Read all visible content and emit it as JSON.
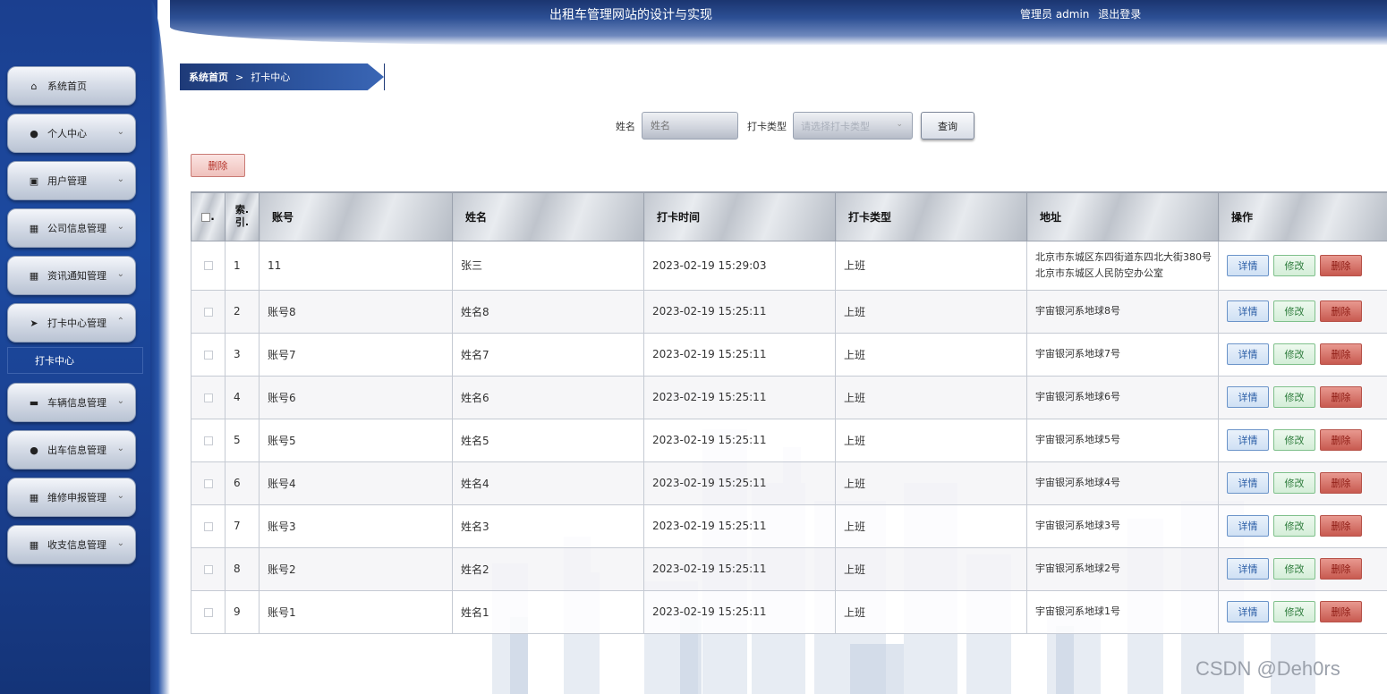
{
  "header": {
    "title": "出租车管理网站的设计与实现",
    "user_label": "管理员 admin",
    "logout_label": "退出登录"
  },
  "sidebar": {
    "items": [
      {
        "label": "系统首页",
        "icon": "home-icon",
        "has_chevron": false
      },
      {
        "label": "个人中心",
        "icon": "person-icon",
        "has_chevron": true
      },
      {
        "label": "用户管理",
        "icon": "id-card-icon",
        "has_chevron": true
      },
      {
        "label": "公司信息管理",
        "icon": "grid-icon",
        "has_chevron": true
      },
      {
        "label": "资讯通知管理",
        "icon": "grid-icon",
        "has_chevron": true
      },
      {
        "label": "打卡中心管理",
        "icon": "send-icon",
        "has_chevron": true,
        "expanded": true
      },
      {
        "label": "车辆信息管理",
        "icon": "car-icon",
        "has_chevron": true
      },
      {
        "label": "出车信息管理",
        "icon": "person-icon",
        "has_chevron": true
      },
      {
        "label": "维修申报管理",
        "icon": "grid-icon",
        "has_chevron": true
      },
      {
        "label": "收支信息管理",
        "icon": "grid-icon",
        "has_chevron": true
      }
    ],
    "submenu_active": "打卡中心"
  },
  "breadcrumb": {
    "home": "系统首页",
    "separator": ">",
    "current": "打卡中心"
  },
  "search": {
    "name_label": "姓名",
    "name_placeholder": "姓名",
    "type_label": "打卡类型",
    "type_placeholder": "请选择打卡类型",
    "query_button": "查询"
  },
  "toolbar": {
    "delete_label": "删除"
  },
  "table": {
    "columns": [
      "",
      "索引",
      "账号",
      "姓名",
      "打卡时间",
      "打卡类型",
      "地址",
      "操作"
    ],
    "index_header_line1": "索.",
    "index_header_line2": "引.",
    "rows": [
      {
        "idx": "1",
        "account": "11",
        "name": "张三",
        "time": "2023-02-19 15:29:03",
        "type": "上班",
        "address_line1": "北京市东城区东四街道东四北大街380号",
        "address_line2": "北京市东城区人民防空办公室"
      },
      {
        "idx": "2",
        "account": "账号8",
        "name": "姓名8",
        "time": "2023-02-19 15:25:11",
        "type": "上班",
        "address_line1": "宇宙银河系地球8号",
        "address_line2": ""
      },
      {
        "idx": "3",
        "account": "账号7",
        "name": "姓名7",
        "time": "2023-02-19 15:25:11",
        "type": "上班",
        "address_line1": "宇宙银河系地球7号",
        "address_line2": ""
      },
      {
        "idx": "4",
        "account": "账号6",
        "name": "姓名6",
        "time": "2023-02-19 15:25:11",
        "type": "上班",
        "address_line1": "宇宙银河系地球6号",
        "address_line2": ""
      },
      {
        "idx": "5",
        "account": "账号5",
        "name": "姓名5",
        "time": "2023-02-19 15:25:11",
        "type": "上班",
        "address_line1": "宇宙银河系地球5号",
        "address_line2": ""
      },
      {
        "idx": "6",
        "account": "账号4",
        "name": "姓名4",
        "time": "2023-02-19 15:25:11",
        "type": "上班",
        "address_line1": "宇宙银河系地球4号",
        "address_line2": ""
      },
      {
        "idx": "7",
        "account": "账号3",
        "name": "姓名3",
        "time": "2023-02-19 15:25:11",
        "type": "上班",
        "address_line1": "宇宙银河系地球3号",
        "address_line2": ""
      },
      {
        "idx": "8",
        "account": "账号2",
        "name": "姓名2",
        "time": "2023-02-19 15:25:11",
        "type": "上班",
        "address_line1": "宇宙银河系地球2号",
        "address_line2": ""
      },
      {
        "idx": "9",
        "account": "账号1",
        "name": "姓名1",
        "time": "2023-02-19 15:25:11",
        "type": "上班",
        "address_line1": "宇宙银河系地球1号",
        "address_line2": ""
      }
    ],
    "row_actions": {
      "detail": "详情",
      "edit": "修改",
      "delete": "删除"
    }
  },
  "watermark": "CSDN @Deh0rs",
  "colors": {
    "sidebar_blue": "#1c4aa0",
    "header_blue": "#2c4f94",
    "detail_blue": "#2a5da6",
    "edit_green": "#2f7d3d",
    "delete_red": "#c85a50"
  }
}
